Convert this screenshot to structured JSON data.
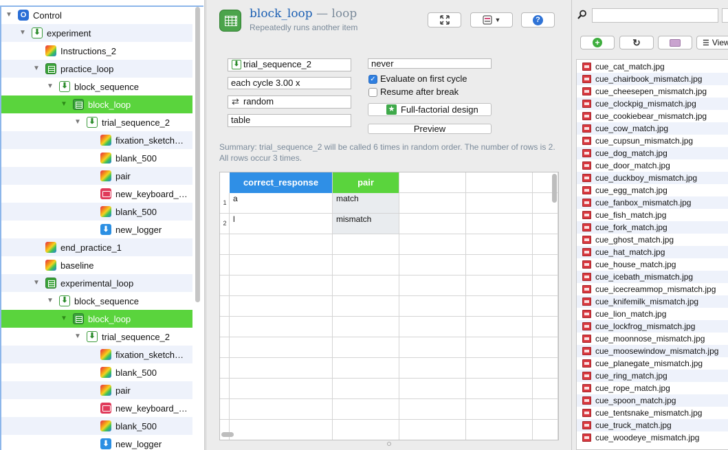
{
  "tree": {
    "items": [
      {
        "label": "Control",
        "icon": "control-icon",
        "expand": "open",
        "depth": 0
      },
      {
        "label": "experiment",
        "icon": "sequence-icon",
        "expand": "open",
        "depth": 1
      },
      {
        "label": "Instructions_2",
        "icon": "sketchpad-icon",
        "expand": "none",
        "depth": 2
      },
      {
        "label": "practice_loop",
        "icon": "loop-icon",
        "expand": "open",
        "depth": 2
      },
      {
        "label": "block_sequence",
        "icon": "sequence-icon",
        "expand": "open",
        "depth": 3
      },
      {
        "label": "block_loop",
        "icon": "loop-icon",
        "expand": "open",
        "depth": 4,
        "selected": true
      },
      {
        "label": "trial_sequence_2",
        "icon": "sequence-icon",
        "expand": "open",
        "depth": 5
      },
      {
        "label": "fixation_sketch…",
        "icon": "sketchpad-icon",
        "expand": "none",
        "depth": 6
      },
      {
        "label": "blank_500",
        "icon": "sketchpad-icon",
        "expand": "none",
        "depth": 6
      },
      {
        "label": "pair",
        "icon": "sketchpad-icon",
        "expand": "none",
        "depth": 6
      },
      {
        "label": "new_keyboard_…",
        "icon": "keyboard-icon",
        "expand": "none",
        "depth": 6
      },
      {
        "label": "blank_500",
        "icon": "sketchpad-icon",
        "expand": "none",
        "depth": 6
      },
      {
        "label": "new_logger",
        "icon": "logger-icon",
        "expand": "none",
        "depth": 6
      },
      {
        "label": "end_practice_1",
        "icon": "sketchpad-icon",
        "expand": "none",
        "depth": 2
      },
      {
        "label": "baseline",
        "icon": "sketchpad-icon",
        "expand": "none",
        "depth": 2
      },
      {
        "label": "experimental_loop",
        "icon": "loop-icon",
        "expand": "open",
        "depth": 2
      },
      {
        "label": "block_sequence",
        "icon": "sequence-icon",
        "expand": "open",
        "depth": 3
      },
      {
        "label": "block_loop",
        "icon": "loop-icon",
        "expand": "open",
        "depth": 4,
        "selected": true
      },
      {
        "label": "trial_sequence_2",
        "icon": "sequence-icon",
        "expand": "open",
        "depth": 5
      },
      {
        "label": "fixation_sketch…",
        "icon": "sketchpad-icon",
        "expand": "none",
        "depth": 6
      },
      {
        "label": "blank_500",
        "icon": "sketchpad-icon",
        "expand": "none",
        "depth": 6
      },
      {
        "label": "pair",
        "icon": "sketchpad-icon",
        "expand": "none",
        "depth": 6
      },
      {
        "label": "new_keyboard_…",
        "icon": "keyboard-icon",
        "expand": "none",
        "depth": 6
      },
      {
        "label": "blank_500",
        "icon": "sketchpad-icon",
        "expand": "none",
        "depth": 6
      },
      {
        "label": "new_logger",
        "icon": "logger-icon",
        "expand": "none",
        "depth": 6
      }
    ]
  },
  "header": {
    "title": "block_loop",
    "type": " — loop",
    "subtitle": "Repeatedly runs another item"
  },
  "toolbar": {
    "maximize_icon": "fullscreen-icon",
    "view_icon": "view-menu-icon",
    "help_icon": "help-icon"
  },
  "loop": {
    "item": "trial_sequence_2",
    "repeat": "each cycle 3.00 x",
    "order": "random",
    "source": "table",
    "break_if": "never",
    "evaluate_first": "Evaluate on first cycle",
    "evaluate_first_checked": true,
    "resume_after_break": "Resume after break",
    "resume_checked": false,
    "full_factorial": "Full-factorial design",
    "preview": "Preview"
  },
  "summary": "Summary: trial_sequence_2 will be called 6 times in random order. The number of rows is 2. All rows occur 3 times.",
  "table": {
    "columns": [
      "correct_response",
      "pair"
    ],
    "column_colors": [
      "#2f8fe6",
      "#5ad43d"
    ],
    "rows": [
      {
        "num": "1",
        "cells": [
          "a",
          "match"
        ]
      },
      {
        "num": "2",
        "cells": [
          "l",
          "mismatch"
        ]
      }
    ]
  },
  "filepool": {
    "view_label": "View",
    "files": [
      "cue_cat_match.jpg",
      "cue_chairbook_mismatch.jpg",
      "cue_cheesepen_mismatch.jpg",
      "cue_clockpig_mismatch.jpg",
      "cue_cookiebear_mismatch.jpg",
      "cue_cow_match.jpg",
      "cue_cupsun_mismatch.jpg",
      "cue_dog_match.jpg",
      "cue_door_match.jpg",
      "cue_duckboy_mismatch.jpg",
      "cue_egg_match.jpg",
      "cue_fanbox_mismatch.jpg",
      "cue_fish_match.jpg",
      "cue_fork_match.jpg",
      "cue_ghost_match.jpg",
      "cue_hat_match.jpg",
      "cue_house_match.jpg",
      "cue_icebath_mismatch.jpg",
      "cue_icecreammop_mismatch.jpg",
      "cue_knifemilk_mismatch.jpg",
      "cue_lion_match.jpg",
      "cue_lockfrog_mismatch.jpg",
      "cue_moonnose_mismatch.jpg",
      "cue_moosewindow_mismatch.jpg",
      "cue_planegate_mismatch.jpg",
      "cue_ring_match.jpg",
      "cue_rope_match.jpg",
      "cue_spoon_match.jpg",
      "cue_tentsnake_mismatch.jpg",
      "cue_truck_match.jpg",
      "cue_woodeye_mismatch.jpg"
    ]
  }
}
